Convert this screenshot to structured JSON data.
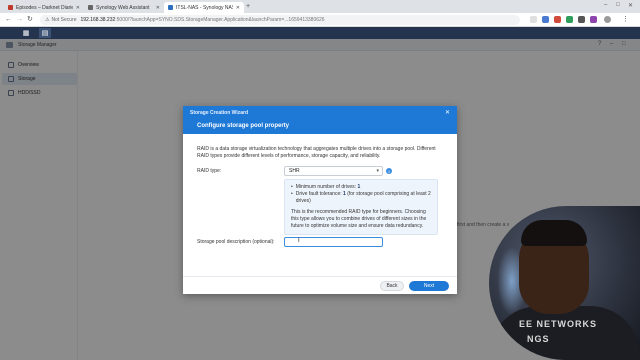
{
  "browser": {
    "tabs": [
      {
        "label": "Episodes – Darknet Diaries",
        "favicon_color": "#c0392b"
      },
      {
        "label": "Synology Web Assistant",
        "favicon_color": "#666666"
      },
      {
        "label": "ITSL-NAS - Synology NAS",
        "favicon_color": "#2c6fbf",
        "active": true
      }
    ],
    "new_tab": "+",
    "url": {
      "security": "Not Secure",
      "host": "192.168.38.232",
      "path": ":5000/?launchApp=SYNO.SDS.StorageManager.Application&launchParam=...1659413380626"
    }
  },
  "app": {
    "title": "Storage Manager",
    "sidebar": [
      {
        "label": "Overview"
      },
      {
        "label": "Storage",
        "active": true
      },
      {
        "label": "HDD/SSD"
      }
    ],
    "background_text": "first and then create a v"
  },
  "wizard": {
    "title": "Storage Creation Wizard",
    "step_title": "Configure storage pool property",
    "description": "RAID is a data storage virtualization technology that aggregates multiple drives into a storage pool. Different RAID types provide different levels of performance, storage capacity, and reliability.",
    "raid_label": "RAID type:",
    "raid_value": "SHR",
    "info": {
      "min_drives_label": "Minimum number of drives:",
      "min_drives_value": "1",
      "fault_label": "Drive fault tolerance:",
      "fault_value": "1",
      "fault_suffix": "(for storage pool comprising at least 2 drives)",
      "note": "This is the recommended RAID type for beginners. Choosing this type allows you to combine drives of different sizes in the future to optimize volume size and ensure data redundancy."
    },
    "pool_desc_label": "Storage pool description (optional):",
    "pool_desc_value": "",
    "back_label": "Back",
    "next_label": "Next"
  },
  "webcam": {
    "shirt_line1": "EE NETWORKS",
    "shirt_line2": "NGS"
  },
  "colors": {
    "accent": "#1e78d6",
    "dsm_bar": "#24344f"
  }
}
